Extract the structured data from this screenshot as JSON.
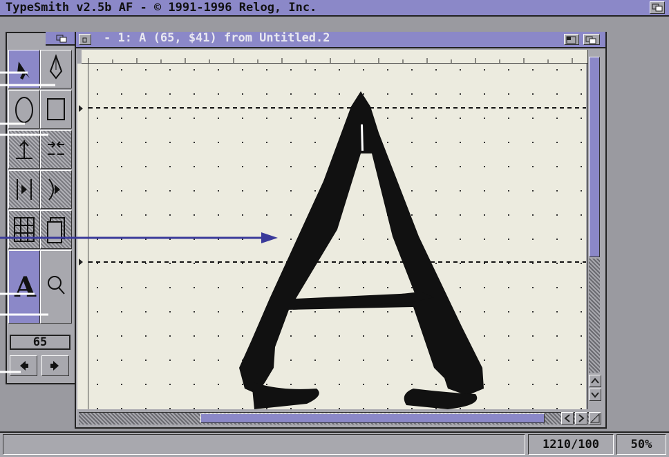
{
  "app": {
    "title": "TypeSmith v2.5b AF - © 1991-1996 Relog, Inc."
  },
  "editor": {
    "window_title": "- 1: A (65, $41) from Untitled.2",
    "glyph": "A"
  },
  "toolbox": {
    "char_code": "65",
    "tools": [
      {
        "name": "pointer-tool",
        "icon": "arrow-pointer-icon"
      },
      {
        "name": "pen-tool",
        "icon": "pen-nib-icon"
      },
      {
        "name": "ellipse-tool",
        "icon": "ellipse-icon"
      },
      {
        "name": "rectangle-tool",
        "icon": "rectangle-icon"
      },
      {
        "name": "align-vertical-tool",
        "icon": "align-vertical-icon"
      },
      {
        "name": "align-horizontal-tool",
        "icon": "align-horizontal-icon"
      },
      {
        "name": "flip-horizontal-tool",
        "icon": "flip-horizontal-icon"
      },
      {
        "name": "flip-curve-tool",
        "icon": "flip-curve-icon"
      },
      {
        "name": "grid-tool",
        "icon": "grid-icon"
      },
      {
        "name": "page-tool",
        "icon": "page-stack-icon"
      },
      {
        "name": "glyph-tool",
        "icon": "glyph-A-icon"
      },
      {
        "name": "zoom-tool",
        "icon": "magnifier-icon"
      }
    ]
  },
  "status": {
    "coords": "1210/100",
    "zoom": "50%"
  },
  "colors": {
    "titlebar": "#8b88c8",
    "chrome": "#a8a8ae",
    "canvas": "#ecebdf",
    "arrow": "#3a3a9a"
  }
}
